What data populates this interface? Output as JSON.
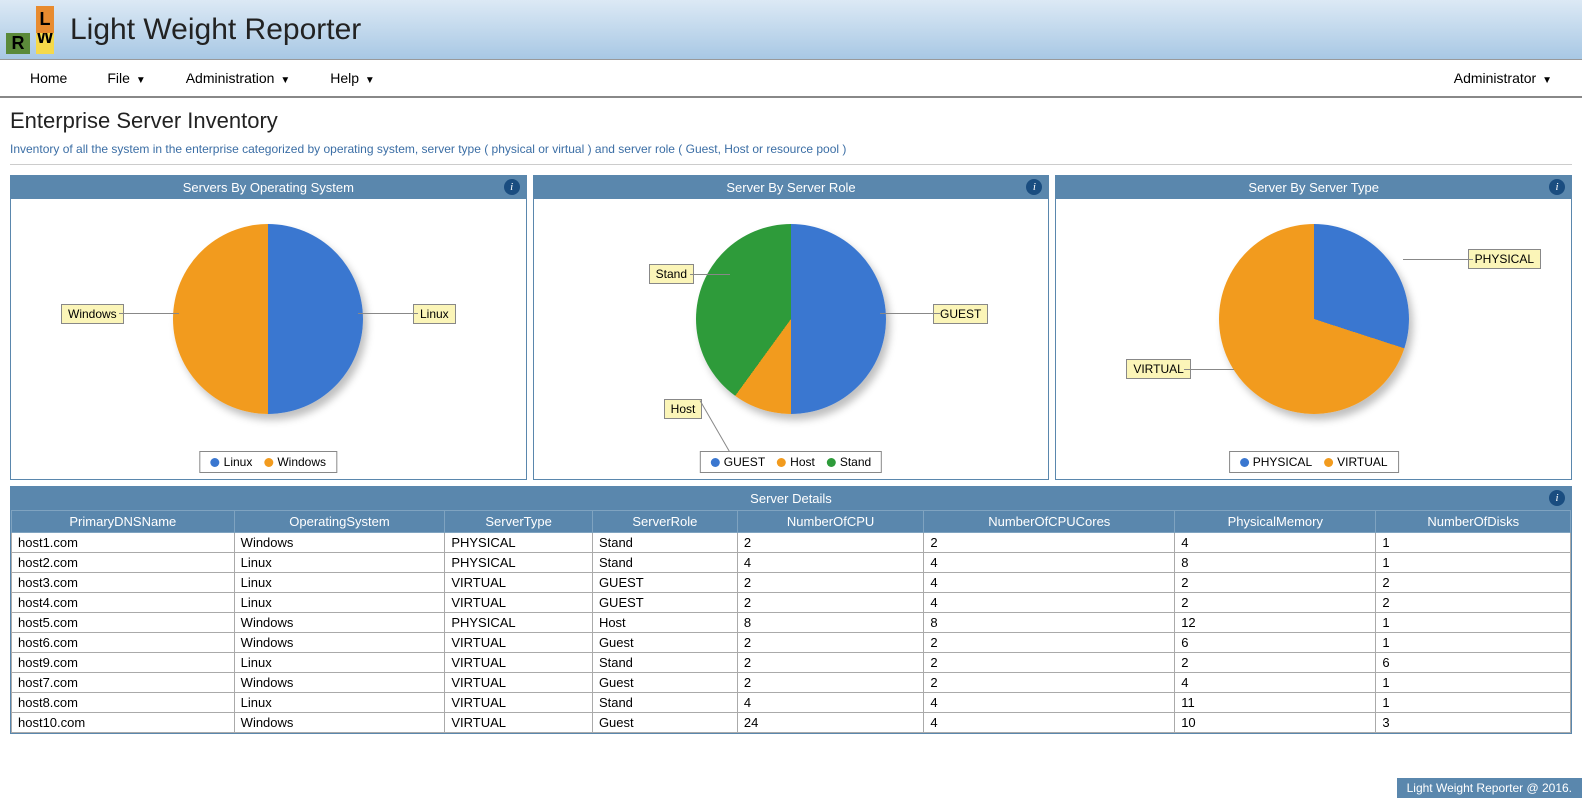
{
  "app_title": "Light Weight Reporter",
  "logo": {
    "L": "L",
    "R": "R",
    "W": "W"
  },
  "menu": {
    "home": "Home",
    "file": "File",
    "admin": "Administration",
    "help": "Help",
    "user": "Administrator"
  },
  "page": {
    "title": "Enterprise Server Inventory",
    "subtitle": "Inventory of all the system in the enterprise categorized by operating system, server type ( physical or virtual ) and server role ( Guest, Host or resource pool )"
  },
  "panels": {
    "os": {
      "title": "Servers By Operating System"
    },
    "role": {
      "title": "Server By Server Role"
    },
    "type": {
      "title": "Server By Server Type"
    },
    "details": {
      "title": "Server Details"
    }
  },
  "chart_data": [
    {
      "type": "pie",
      "title": "Servers By Operating System",
      "series": [
        {
          "name": "Linux",
          "value": 5,
          "color": "#3a77d0"
        },
        {
          "name": "Windows",
          "value": 5,
          "color": "#f29b1e"
        }
      ],
      "legend": [
        "Linux",
        "Windows"
      ]
    },
    {
      "type": "pie",
      "title": "Server By Server Role",
      "series": [
        {
          "name": "GUEST",
          "value": 5,
          "color": "#3a77d0"
        },
        {
          "name": "Host",
          "value": 1,
          "color": "#f29b1e"
        },
        {
          "name": "Stand",
          "value": 4,
          "color": "#2e9b3a"
        }
      ],
      "legend": [
        "GUEST",
        "Host",
        "Stand"
      ]
    },
    {
      "type": "pie",
      "title": "Server By Server Type",
      "series": [
        {
          "name": "PHYSICAL",
          "value": 3,
          "color": "#3a77d0"
        },
        {
          "name": "VIRTUAL",
          "value": 7,
          "color": "#f29b1e"
        }
      ],
      "legend": [
        "PHYSICAL",
        "VIRTUAL"
      ]
    }
  ],
  "callouts": {
    "os": {
      "left": "Windows",
      "right": "Linux"
    },
    "role": {
      "right": "GUEST",
      "bottom": "Host",
      "topleft": "Stand"
    },
    "type": {
      "right": "PHYSICAL",
      "left": "VIRTUAL"
    }
  },
  "table": {
    "columns": [
      "PrimaryDNSName",
      "OperatingSystem",
      "ServerType",
      "ServerRole",
      "NumberOfCPU",
      "NumberOfCPUCores",
      "PhysicalMemory",
      "NumberOfDisks"
    ],
    "rows": [
      [
        "host1.com",
        "Windows",
        "PHYSICAL",
        "Stand",
        "2",
        "2",
        "4",
        "1"
      ],
      [
        "host2.com",
        "Linux",
        "PHYSICAL",
        "Stand",
        "4",
        "4",
        "8",
        "1"
      ],
      [
        "host3.com",
        "Linux",
        "VIRTUAL",
        "GUEST",
        "2",
        "4",
        "2",
        "2"
      ],
      [
        "host4.com",
        "Linux",
        "VIRTUAL",
        "GUEST",
        "2",
        "4",
        "2",
        "2"
      ],
      [
        "host5.com",
        "Windows",
        "PHYSICAL",
        "Host",
        "8",
        "8",
        "12",
        "1"
      ],
      [
        "host6.com",
        "Windows",
        "VIRTUAL",
        "Guest",
        "2",
        "2",
        "6",
        "1"
      ],
      [
        "host9.com",
        "Linux",
        "VIRTUAL",
        "Stand",
        "2",
        "2",
        "2",
        "6"
      ],
      [
        "host7.com",
        "Windows",
        "VIRTUAL",
        "Guest",
        "2",
        "2",
        "4",
        "1"
      ],
      [
        "host8.com",
        "Linux",
        "VIRTUAL",
        "Stand",
        "4",
        "4",
        "11",
        "1"
      ],
      [
        "host10.com",
        "Windows",
        "VIRTUAL",
        "Guest",
        "24",
        "4",
        "10",
        "3"
      ]
    ]
  },
  "footer": "Light Weight Reporter @ 2016."
}
